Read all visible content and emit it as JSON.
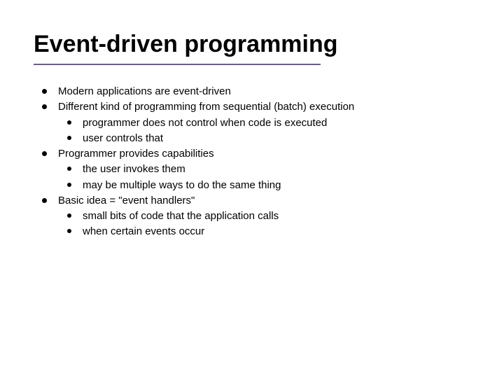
{
  "title": "Event-driven programming",
  "bullets": [
    {
      "text": "Modern applications are event-driven",
      "subs": []
    },
    {
      "text": "Different kind of programming from sequential (batch) execution",
      "subs": [
        "programmer does not control when code is executed",
        "user controls that"
      ]
    },
    {
      "text": "Programmer provides capabilities",
      "subs": [
        "the user invokes them",
        "may be multiple ways to do the same thing"
      ]
    },
    {
      "text": "Basic idea = \"event handlers\"",
      "subs": [
        "small bits of code that the application calls",
        "when certain events occur"
      ]
    }
  ]
}
